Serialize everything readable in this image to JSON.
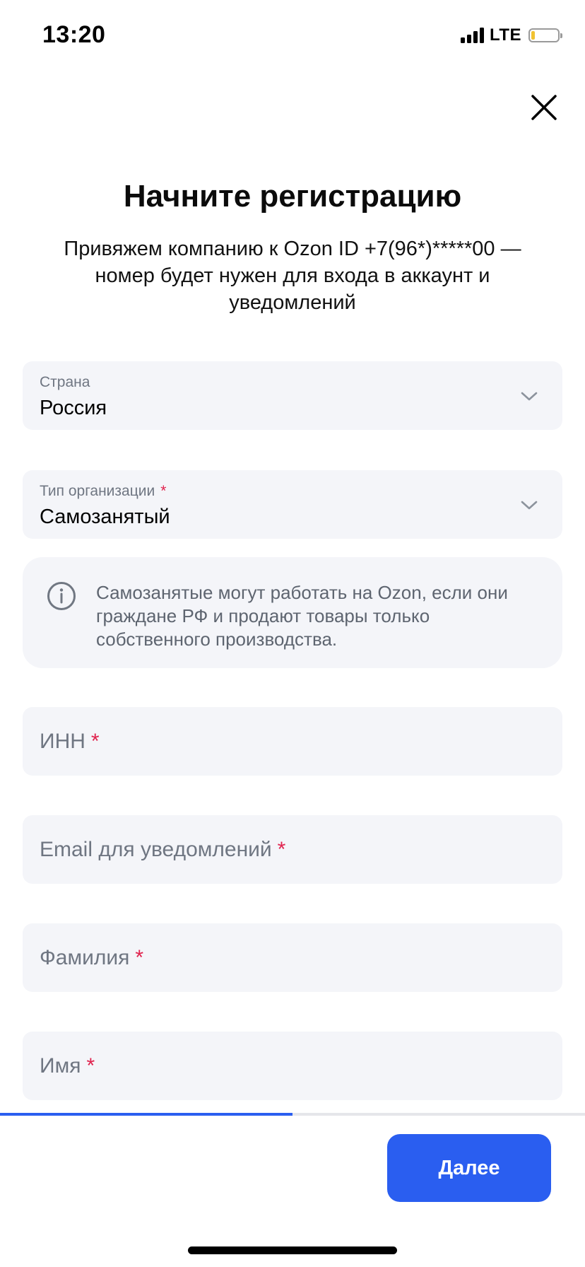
{
  "status_bar": {
    "time": "13:20",
    "network": "LTE",
    "battery_level": 0.15
  },
  "header": {
    "title": "Начните регистрацию",
    "subtitle": "Привяжем компанию к Ozon ID +7(96*)*****00 — номер будет нужен для входа в аккаунт и уведомлений"
  },
  "form": {
    "country": {
      "label": "Страна",
      "value": "Россия"
    },
    "org_type": {
      "label": "Тип организации",
      "required_mark": "*",
      "value": "Самозанятый"
    },
    "info": {
      "text": "Самозанятые могут работать на Ozon, если они граждане РФ и продают товары только собственного производства."
    },
    "inn": {
      "placeholder": "ИНН",
      "required_mark": "*"
    },
    "email": {
      "placeholder": "Email для уведомлений",
      "required_mark": "*"
    },
    "last_name": {
      "placeholder": "Фамилия",
      "required_mark": "*"
    },
    "first_name": {
      "placeholder": "Имя",
      "required_mark": "*"
    }
  },
  "progress": {
    "fraction": 0.5
  },
  "footer": {
    "next_label": "Далее"
  },
  "colors": {
    "accent": "#2a5ef0",
    "required": "#e0234e",
    "field_bg": "#f4f5f9"
  }
}
